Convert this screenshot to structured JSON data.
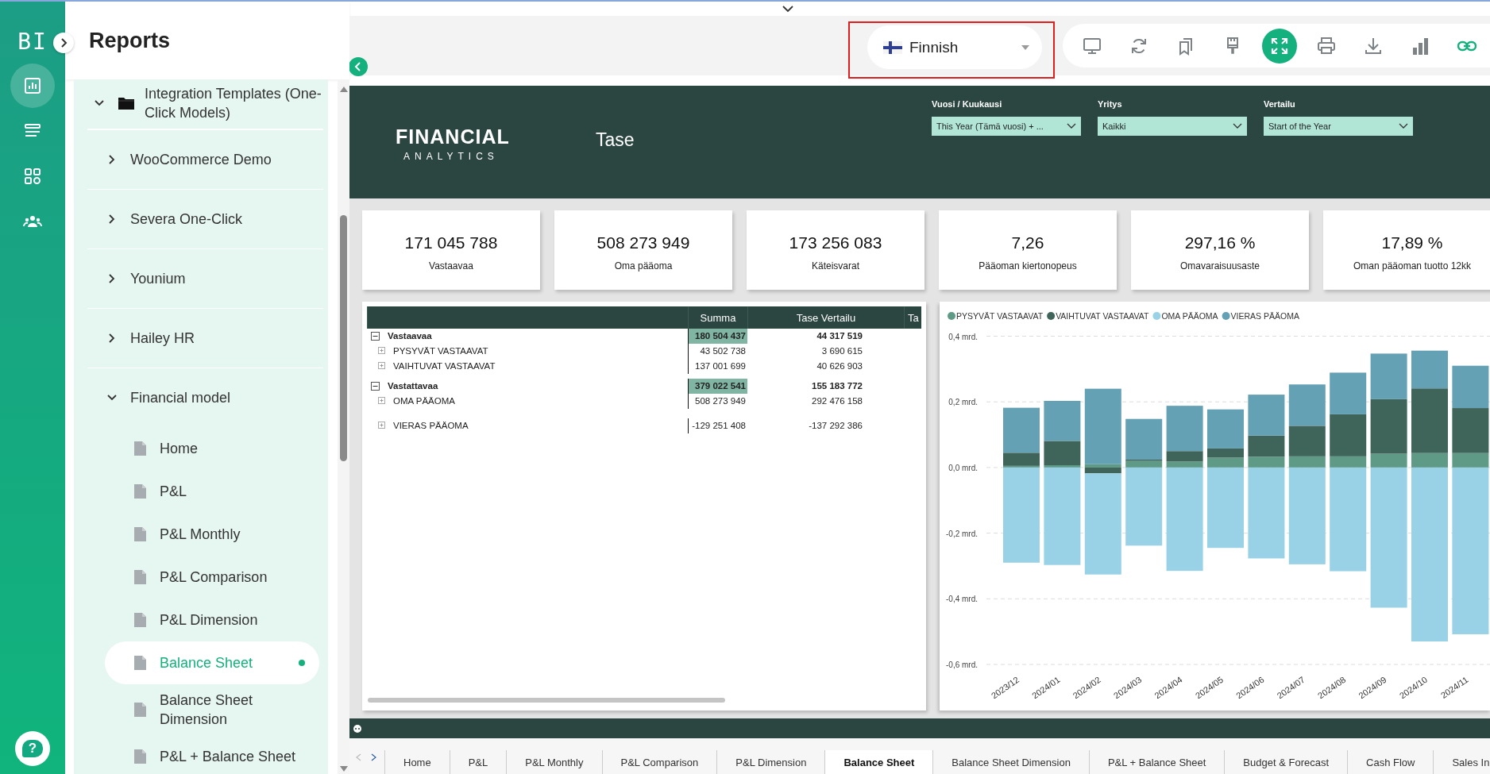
{
  "app": {
    "logo": "BI",
    "help": "?"
  },
  "rail": {
    "items": [
      {
        "kind": "reports",
        "selected": true
      },
      {
        "kind": "list",
        "selected": false
      },
      {
        "kind": "apps",
        "selected": false
      },
      {
        "kind": "users",
        "selected": false
      }
    ]
  },
  "sidebar": {
    "title": "Reports",
    "tree": [
      {
        "label": "Integration Templates (One-Click Models)",
        "kind": "folder",
        "expanded": true,
        "children": [
          {
            "label": "WooCommerce Demo",
            "kind": "group",
            "expanded": false
          },
          {
            "label": "Severa One-Click",
            "kind": "group",
            "expanded": false
          },
          {
            "label": "Younium",
            "kind": "group",
            "expanded": false
          },
          {
            "label": "Hailey HR",
            "kind": "group",
            "expanded": false
          },
          {
            "label": "Financial model",
            "kind": "group",
            "expanded": true,
            "children": [
              {
                "label": "Home",
                "kind": "report",
                "selected": false
              },
              {
                "label": "P&L",
                "kind": "report",
                "selected": false
              },
              {
                "label": "P&L Monthly",
                "kind": "report",
                "selected": false
              },
              {
                "label": "P&L Comparison",
                "kind": "report",
                "selected": false
              },
              {
                "label": "P&L Dimension",
                "kind": "report",
                "selected": false
              },
              {
                "label": "Balance Sheet",
                "kind": "report",
                "selected": true
              },
              {
                "label": "Balance Sheet Dimension",
                "kind": "report",
                "selected": false
              },
              {
                "label": "P&L + Balance Sheet",
                "kind": "report",
                "selected": false
              }
            ]
          }
        ]
      }
    ]
  },
  "toolbar": {
    "language": {
      "label": "Finnish",
      "highlighted": true
    },
    "tools": [
      {
        "kind": "monitor",
        "active": false
      },
      {
        "kind": "refresh",
        "active": false
      },
      {
        "kind": "bookmarks",
        "active": false
      },
      {
        "kind": "brush",
        "active": false
      },
      {
        "kind": "fullscreen",
        "active": true
      },
      {
        "kind": "print",
        "active": false
      },
      {
        "kind": "download",
        "active": false
      },
      {
        "kind": "bars",
        "active": false
      },
      {
        "kind": "link",
        "active": false
      }
    ]
  },
  "report": {
    "logo_line_1": "FINANCIAL",
    "logo_line_2": "ANALYTICS",
    "title": "Tase",
    "filters": [
      {
        "label": "Vuosi / Kuukausi",
        "value": "This Year (Tämä vuosi) + ..."
      },
      {
        "label": "Yritys",
        "value": "Kaikki"
      },
      {
        "label": "Vertailu",
        "value": "Start of the Year"
      }
    ],
    "kpis": [
      {
        "value": "171 045 788",
        "label": "Vastaavaa"
      },
      {
        "value": "508 273 949",
        "label": "Oma pääoma"
      },
      {
        "value": "173 256 083",
        "label": "Käteisvarat"
      },
      {
        "value": "7,26",
        "label": "Pääoman kiertonopeus"
      },
      {
        "value": "297,16 %",
        "label": "Omavaraisuusaste"
      },
      {
        "value": "17,89 %",
        "label": "Oman pääoman tuotto 12kk"
      }
    ],
    "table": {
      "columns": [
        "Summa",
        "Tase Vertailu",
        "Ta"
      ],
      "rows": [
        {
          "label": "Vastaavaa",
          "expanded": true,
          "values": [
            "180 504 437",
            "44 317 519"
          ],
          "children": [
            {
              "label": "PYSYVÄT VASTAAVAT",
              "expanded": false,
              "values": [
                "43 502 738",
                "3 690 615"
              ]
            },
            {
              "label": "VAIHTUVAT VASTAAVAT",
              "expanded": false,
              "values": [
                "137 001 699",
                "40 626 903"
              ]
            }
          ]
        },
        {
          "label": "Vastattavaa",
          "expanded": true,
          "values": [
            "379 022 541",
            "155 183 772"
          ],
          "children": [
            {
              "label": "OMA PÄÄOMA",
              "expanded": false,
              "values": [
                "508 273 949",
                "292 476 158"
              ]
            },
            {
              "label": "VIERAS PÄÄOMA",
              "expanded": false,
              "values": [
                "-129 251 408",
                "-137 292 386"
              ]
            }
          ]
        }
      ]
    },
    "chart": {
      "chart_data": {
        "type": "bar",
        "stacked": true,
        "orientation": "vertical",
        "grid": true,
        "legend": true,
        "categories": [
          "2023/12",
          "2024/01",
          "2024/02",
          "2024/03",
          "2024/04",
          "2024/05",
          "2024/06",
          "2024/07",
          "2024/08",
          "2024/09",
          "2024/10",
          "2024/11"
        ],
        "series": [
          {
            "name": "PYSYVÄT VASTAAVAT",
            "color": "#5e9a86",
            "values": [
              0.005,
              0.007,
              0.01,
              0.02,
              0.018,
              0.03,
              0.033,
              0.034,
              0.034,
              0.042,
              0.044,
              0.044
            ]
          },
          {
            "name": "VAIHTUVAT VASTAAVAT",
            "color": "#3f6459",
            "values": [
              0.04,
              0.074,
              -0.018,
              0.004,
              0.032,
              0.028,
              0.064,
              0.093,
              0.128,
              0.166,
              0.197,
              0.137
            ]
          },
          {
            "name": "OMA PÄÄOMA",
            "color": "#99d2e6",
            "values": [
              -0.29,
              -0.297,
              -0.308,
              -0.238,
              -0.315,
              -0.245,
              -0.277,
              -0.295,
              -0.316,
              -0.427,
              -0.53,
              -0.508
            ]
          },
          {
            "name": "VIERAS PÄÄOMA",
            "color": "#64a1b5",
            "values": [
              0.137,
              0.122,
              0.23,
              0.124,
              0.138,
              0.119,
              0.125,
              0.126,
              0.127,
              0.139,
              0.115,
              0.129
            ]
          }
        ],
        "ylim": [
          -0.6,
          0.4
        ],
        "yticks": [
          {
            "value": 0.4,
            "label": "0,4 mrd."
          },
          {
            "value": 0.2,
            "label": "0,2 mrd."
          },
          {
            "value": 0,
            "label": "0,0 mrd."
          },
          {
            "value": -0.2,
            "label": "-0,2 mrd."
          },
          {
            "value": -0.4,
            "label": "-0,4 mrd."
          },
          {
            "value": -0.6,
            "label": "-0,6 mrd."
          }
        ]
      }
    }
  },
  "pages": [
    {
      "label": "Home",
      "selected": false
    },
    {
      "label": "P&L",
      "selected": false
    },
    {
      "label": "P&L Monthly",
      "selected": false
    },
    {
      "label": "P&L Comparison",
      "selected": false
    },
    {
      "label": "P&L Dimension",
      "selected": false
    },
    {
      "label": "Balance Sheet",
      "selected": true
    },
    {
      "label": "Balance Sheet Dimension",
      "selected": false
    },
    {
      "label": "P&L + Balance Sheet",
      "selected": false
    },
    {
      "label": "Budget & Forecast",
      "selected": false
    },
    {
      "label": "Cash Flow",
      "selected": false
    },
    {
      "label": "Sales In",
      "selected": false
    }
  ]
}
